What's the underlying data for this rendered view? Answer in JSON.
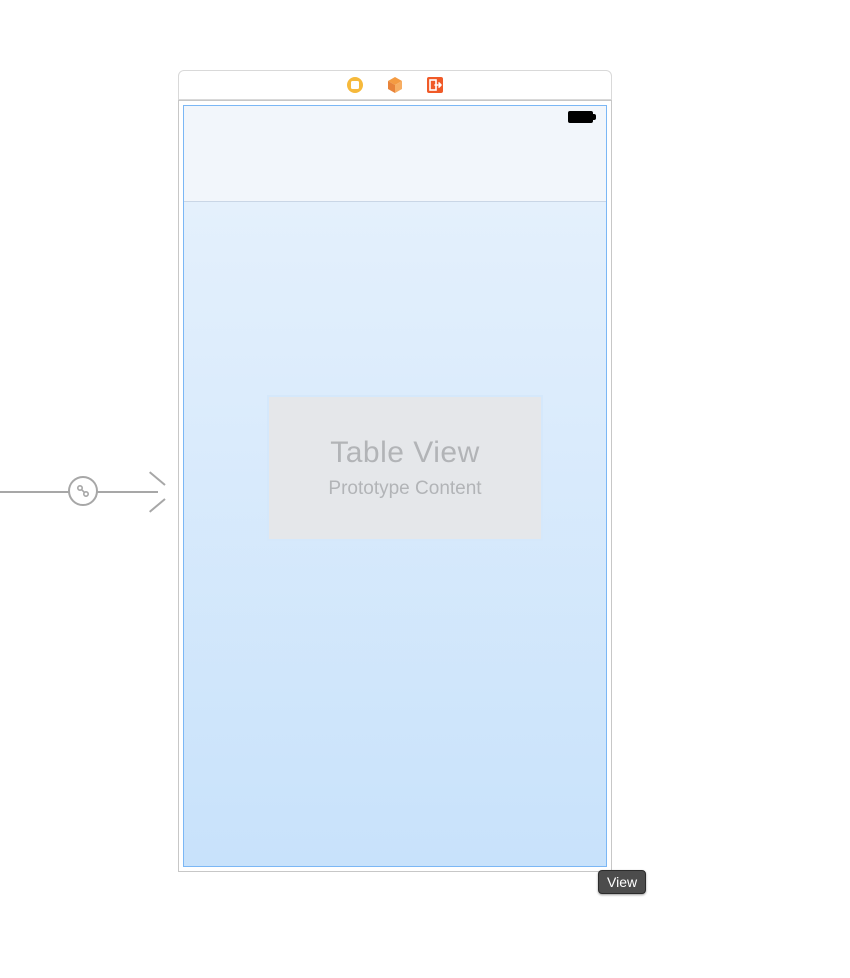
{
  "scene": {
    "titlebar_icons": [
      "view-controller-icon",
      "first-responder-icon",
      "exit-icon"
    ]
  },
  "status_bar": {
    "battery_level": "full"
  },
  "table_placeholder": {
    "title": "Table View",
    "subtitle": "Prototype Content"
  },
  "selection": {
    "label": "View"
  },
  "segue": {
    "type": "initial-view-controller"
  }
}
